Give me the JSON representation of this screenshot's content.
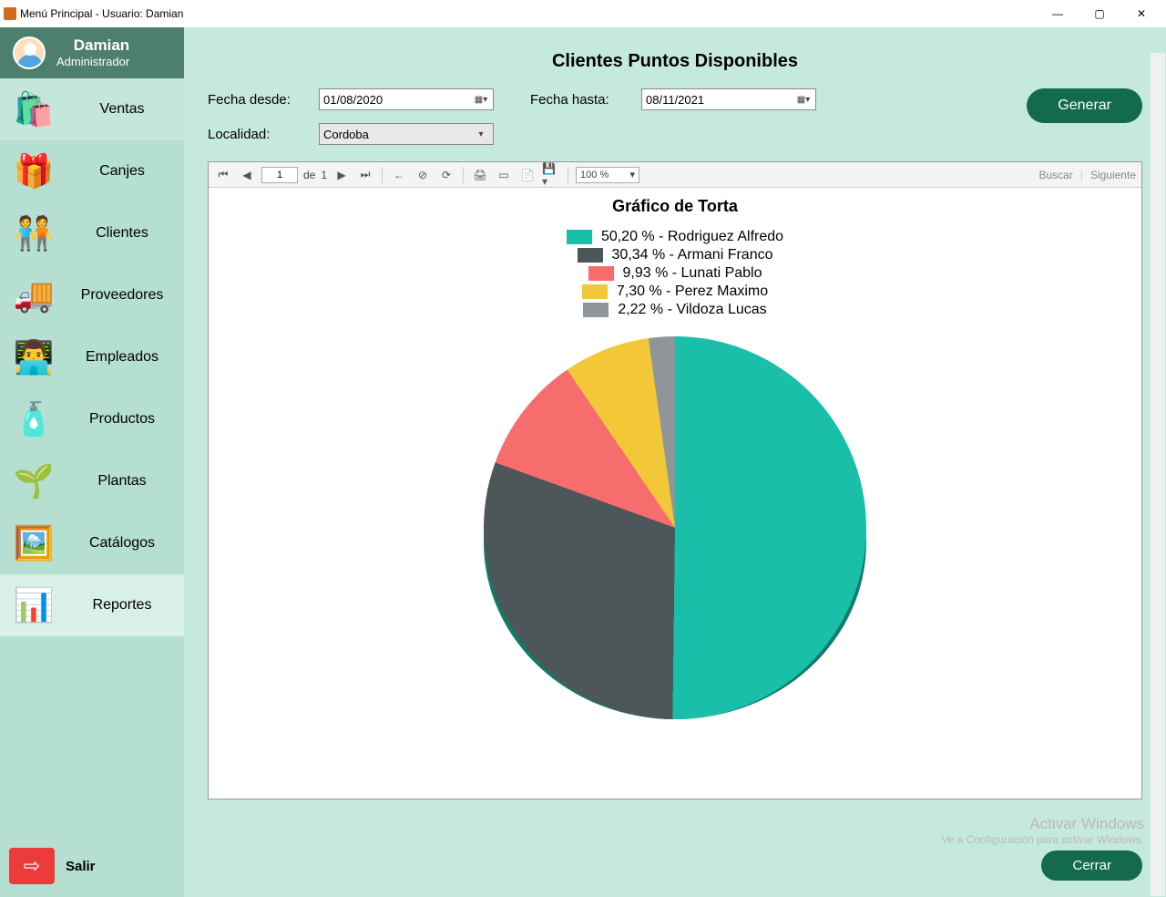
{
  "window": {
    "title": "Menú Principal - Usuario: Damian"
  },
  "user": {
    "name": "Damian",
    "role": "Administrador"
  },
  "sidebar": {
    "items": [
      {
        "label": "Ventas",
        "icon": "🛍️"
      },
      {
        "label": "Canjes",
        "icon": "🎁"
      },
      {
        "label": "Clientes",
        "icon": "🧑‍🤝‍🧑"
      },
      {
        "label": "Proveedores",
        "icon": "🚚"
      },
      {
        "label": "Empleados",
        "icon": "👨‍💻"
      },
      {
        "label": "Productos",
        "icon": "🧴"
      },
      {
        "label": "Plantas",
        "icon": "🌱"
      },
      {
        "label": "Catálogos",
        "icon": "🖼️"
      },
      {
        "label": "Reportes",
        "icon": "📊"
      }
    ],
    "exit_label": "Salir"
  },
  "page": {
    "title": "Clientes Puntos Disponibles",
    "from_label": "Fecha desde:",
    "to_label": "Fecha hasta:",
    "loc_label": "Localidad:",
    "from_value": "01/08/2020",
    "to_value": "08/11/2021",
    "loc_value": "Cordoba",
    "generate_label": "Generar",
    "close_label": "Cerrar"
  },
  "report_toolbar": {
    "page_current": "1",
    "page_of": "de",
    "page_total": "1",
    "zoom": "100 %",
    "search_label": "Buscar",
    "next_label": "Siguiente"
  },
  "chart_data": {
    "type": "pie",
    "title": "Gráfico de Torta",
    "series": [
      {
        "name": "Rodriguez Alfredo",
        "value": 50.2,
        "color": "#19bfa8",
        "label": "50,20 % - Rodriguez Alfredo"
      },
      {
        "name": "Armani Franco",
        "value": 30.34,
        "color": "#4d5659",
        "label": "30,34 % - Armani Franco"
      },
      {
        "name": "Lunati Pablo",
        "value": 9.93,
        "color": "#f76d6d",
        "label": "9,93 % - Lunati Pablo"
      },
      {
        "name": "Perez Maximo",
        "value": 7.3,
        "color": "#f2c838",
        "label": "7,30 % - Perez Maximo"
      },
      {
        "name": "Vildoza Lucas",
        "value": 2.22,
        "color": "#8f9599",
        "label": "2,22 % - Vildoza Lucas"
      }
    ]
  },
  "watermark": {
    "line1": "Activar Windows",
    "line2": "Ve a Configuración para activar Windows."
  }
}
